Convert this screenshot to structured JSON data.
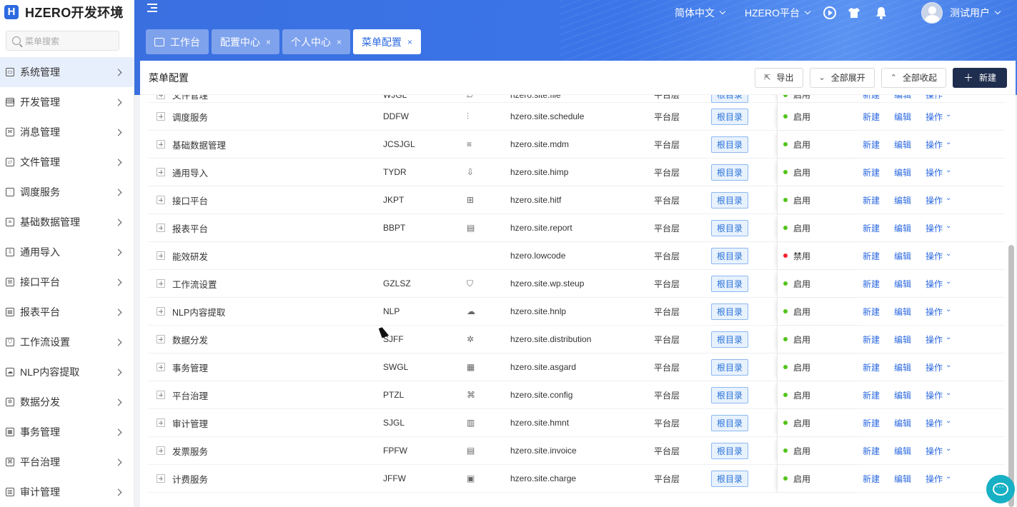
{
  "app": {
    "logo_letter": "H",
    "title": "HZERO开发环境"
  },
  "sidebar": {
    "search_placeholder": "菜单搜索",
    "items": [
      {
        "label": "系统管理",
        "icon": "monitor-icon"
      },
      {
        "label": "开发管理",
        "icon": "code-icon"
      },
      {
        "label": "消息管理",
        "icon": "message-icon"
      },
      {
        "label": "文件管理",
        "icon": "folder-icon"
      },
      {
        "label": "调度服务",
        "icon": "sliders-icon"
      },
      {
        "label": "基础数据管理",
        "icon": "database-icon"
      },
      {
        "label": "通用导入",
        "icon": "import-icon"
      },
      {
        "label": "接口平台",
        "icon": "interface-icon"
      },
      {
        "label": "报表平台",
        "icon": "report-icon"
      },
      {
        "label": "工作流设置",
        "icon": "shield-icon"
      },
      {
        "label": "NLP内容提取",
        "icon": "cloud-icon"
      },
      {
        "label": "数据分发",
        "icon": "distribution-icon"
      },
      {
        "label": "事务管理",
        "icon": "transaction-icon"
      },
      {
        "label": "平台治理",
        "icon": "governance-icon"
      },
      {
        "label": "审计管理",
        "icon": "chart-icon"
      }
    ]
  },
  "topbar": {
    "language": "简体中文",
    "platform": "HZERO平台",
    "username": "测试用户"
  },
  "tabs": [
    {
      "label": "工作台",
      "closable": false
    },
    {
      "label": "配置中心",
      "closable": true
    },
    {
      "label": "个人中心",
      "closable": true
    },
    {
      "label": "菜单配置",
      "closable": true,
      "active": true
    }
  ],
  "close_glyph": "×",
  "page": {
    "title": "菜单配置",
    "export": "导出",
    "expand_all": "全部展开",
    "collapse_all": "全部收起",
    "create": "新建"
  },
  "table": {
    "actions": {
      "new": "新建",
      "edit": "编辑",
      "ops": "操作"
    },
    "rows": [
      {
        "name": "文件管理",
        "code": "WJGL",
        "icon": "folder-icon",
        "route": "hzero.site.file",
        "level": "平台层",
        "tag": "根目录",
        "status": "启用",
        "enabled": true
      },
      {
        "name": "调度服务",
        "code": "DDFW",
        "icon": "sliders-icon",
        "route": "hzero.site.schedule",
        "level": "平台层",
        "tag": "根目录",
        "status": "启用",
        "enabled": true
      },
      {
        "name": "基础数据管理",
        "code": "JCSJGL",
        "icon": "database-icon",
        "route": "hzero.site.mdm",
        "level": "平台层",
        "tag": "根目录",
        "status": "启用",
        "enabled": true
      },
      {
        "name": "通用导入",
        "code": "TYDR",
        "icon": "import-icon",
        "route": "hzero.site.himp",
        "level": "平台层",
        "tag": "根目录",
        "status": "启用",
        "enabled": true
      },
      {
        "name": "接口平台",
        "code": "JKPT",
        "icon": "interface-icon",
        "route": "hzero.site.hitf",
        "level": "平台层",
        "tag": "根目录",
        "status": "启用",
        "enabled": true
      },
      {
        "name": "报表平台",
        "code": "BBPT",
        "icon": "report-icon",
        "route": "hzero.site.report",
        "level": "平台层",
        "tag": "根目录",
        "status": "启用",
        "enabled": true
      },
      {
        "name": "能效研发",
        "code": "",
        "icon": "",
        "route": "hzero.lowcode",
        "level": "平台层",
        "tag": "根目录",
        "status": "禁用",
        "enabled": false
      },
      {
        "name": "工作流设置",
        "code": "GZLSZ",
        "icon": "shield-icon",
        "route": "hzero.site.wp.steup",
        "level": "平台层",
        "tag": "根目录",
        "status": "启用",
        "enabled": true
      },
      {
        "name": "NLP内容提取",
        "code": "NLP",
        "icon": "cloud-icon",
        "route": "hzero.site.hnlp",
        "level": "平台层",
        "tag": "根目录",
        "status": "启用",
        "enabled": true
      },
      {
        "name": "数据分发",
        "code": "SJFF",
        "icon": "distribution-icon",
        "route": "hzero.site.distribution",
        "level": "平台层",
        "tag": "根目录",
        "status": "启用",
        "enabled": true
      },
      {
        "name": "事务管理",
        "code": "SWGL",
        "icon": "transaction-icon",
        "route": "hzero.site.asgard",
        "level": "平台层",
        "tag": "根目录",
        "status": "启用",
        "enabled": true
      },
      {
        "name": "平台治理",
        "code": "PTZL",
        "icon": "governance-icon",
        "route": "hzero.site.config",
        "level": "平台层",
        "tag": "根目录",
        "status": "启用",
        "enabled": true
      },
      {
        "name": "审计管理",
        "code": "SJGL",
        "icon": "chart-icon",
        "route": "hzero.site.hmnt",
        "level": "平台层",
        "tag": "根目录",
        "status": "启用",
        "enabled": true
      },
      {
        "name": "发票服务",
        "code": "FPFW",
        "icon": "report-icon",
        "route": "hzero.site.invoice",
        "level": "平台层",
        "tag": "根目录",
        "status": "启用",
        "enabled": true
      },
      {
        "name": "计费服务",
        "code": "JFFW",
        "icon": "billing-icon",
        "route": "hzero.site.charge",
        "level": "平台层",
        "tag": "根目录",
        "status": "启用",
        "enabled": true
      }
    ]
  },
  "colors": {
    "brand": "#2d6ae0",
    "primary_button": "#1f2d4f",
    "enabled": "#52c41a",
    "disabled": "#f5222d"
  }
}
